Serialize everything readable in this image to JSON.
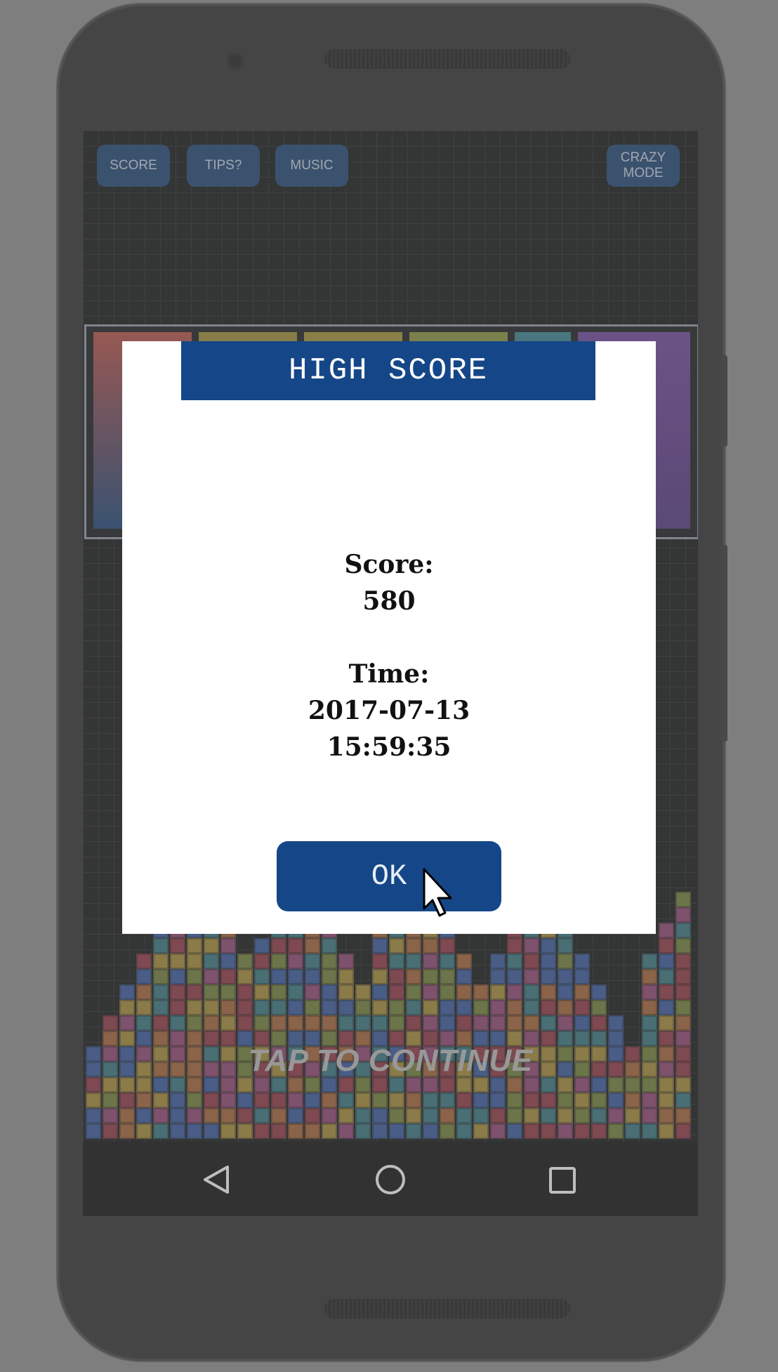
{
  "toolbar": {
    "score_label": "SCORE",
    "tips_label": "TIPS?",
    "music_label": "MUSIC",
    "crazy_line1": "CRAZY",
    "crazy_line2": "MODE"
  },
  "game": {
    "tap_prompt": "TAP TO CONTINUE"
  },
  "dialog": {
    "title": "HIGH SCORE",
    "score_label": "Score:",
    "score_value": "580",
    "time_label": "Time:",
    "time_date": "2017-07-13",
    "time_clock": "15:59:35",
    "ok_label": "OK"
  },
  "navbar": {
    "back_icon": "back-triangle-icon",
    "home_icon": "home-circle-icon",
    "recents_icon": "recents-square-icon"
  },
  "colors": {
    "accent": "#154788",
    "dim_overlay": "#6e6e6e"
  }
}
